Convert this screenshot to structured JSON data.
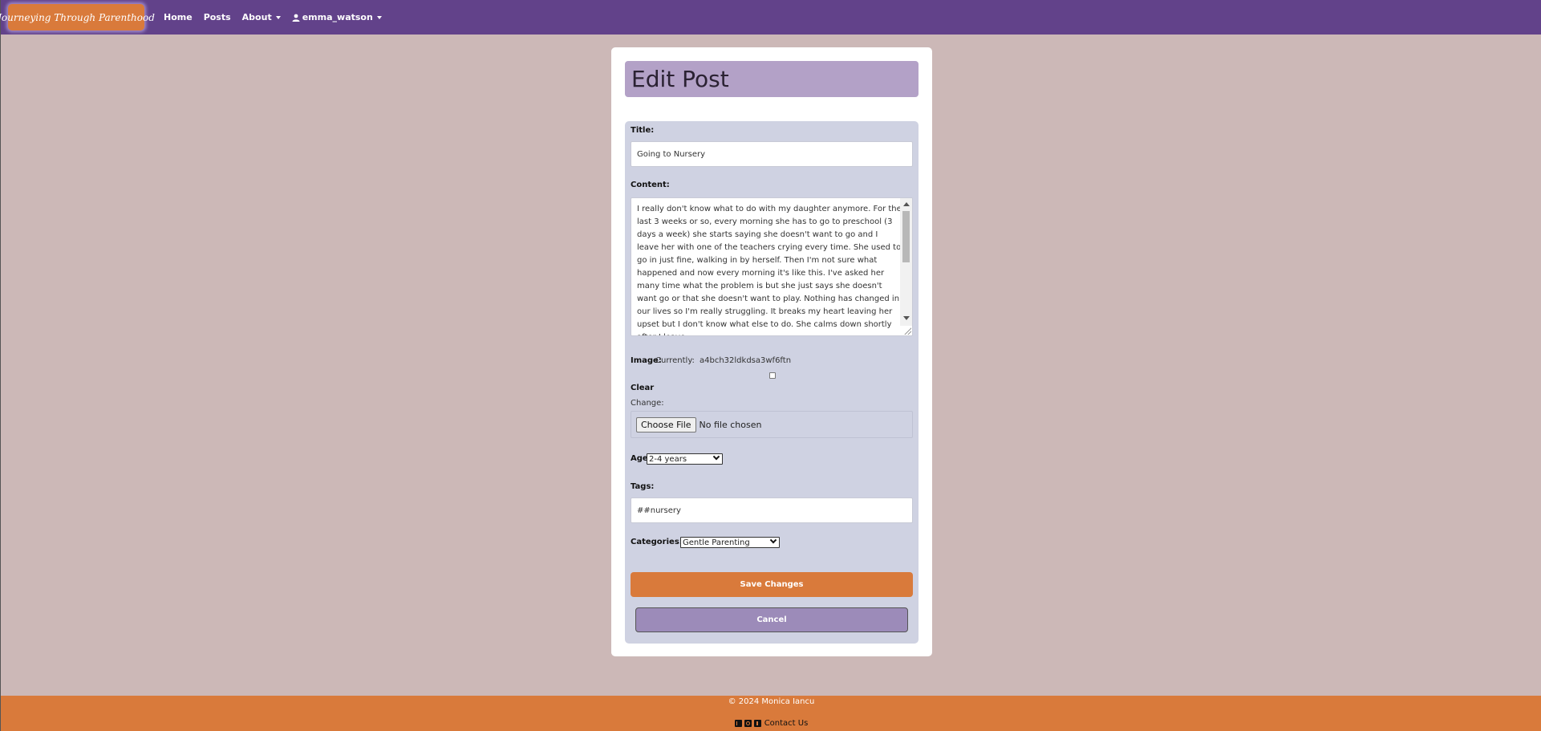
{
  "navbar": {
    "brand": "Journeying Through Parenthood",
    "links": {
      "home": "Home",
      "posts": "Posts",
      "about": "About",
      "user": "emma_watson"
    }
  },
  "page": {
    "heading": "Edit Post"
  },
  "form": {
    "title_label": "Title:",
    "title_value": "Going to Nursery",
    "content_label": "Content:",
    "content_value": "I really don't know what to do with my daughter anymore. For the last 3 weeks or so, every morning she has to go to preschool (3 days a week) she starts saying she doesn't want to go and I leave her with one of the teachers crying every time. She used to go in just fine, walking in by herself. Then I'm not sure what happened and now every morning it's like this. I've asked her many time what the problem is but she just says she doesn't want go or that she doesn't want to play. Nothing has changed in our lives so I'm really struggling. It breaks my heart leaving her upset but I don't know what else to do. She calms down shortly after I leave",
    "image_label": "Image:",
    "image_current_prefix": "Currently:",
    "image_current_value": "a4bch32ldkdsa3wf6ftn",
    "clear_label": "Clear",
    "change_label": "Change:",
    "file_button": "Choose File",
    "file_status": "No file chosen",
    "age_label": "Age:",
    "age_value": "2-4 years",
    "tags_label": "Tags:",
    "tags_value": "##nursery",
    "categories_label": "Categories:",
    "categories_value": "Gentle Parenting",
    "save_label": "Save Changes",
    "cancel_label": "Cancel"
  },
  "footer": {
    "copyright": "© 2024 Monica Iancu",
    "contact": "Contact Us",
    "icons": [
      "linkedin-icon",
      "instagram-icon",
      "tiktok-icon"
    ]
  },
  "colors": {
    "navbar": "#62428a",
    "accent": "#d97a3b",
    "background": "#ccb8b7",
    "heading_box": "#b3a1c7",
    "form_box": "#cfd2e2",
    "cancel": "#9c8bb9"
  }
}
